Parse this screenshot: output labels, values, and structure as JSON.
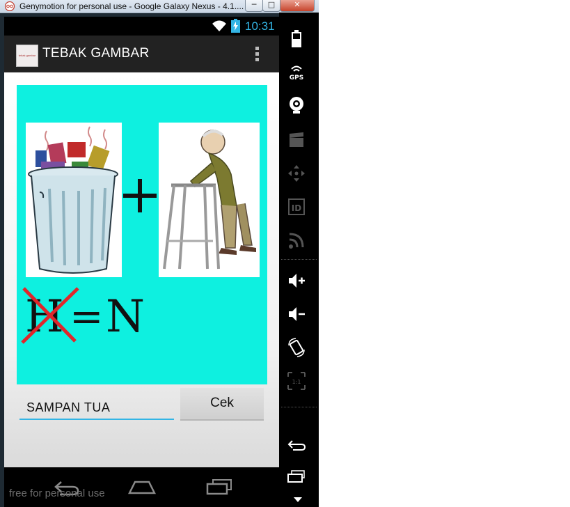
{
  "window": {
    "title": "Genymotion for personal use - Google Galaxy Nexus - 4.1....",
    "minimize_glyph": "─",
    "maximize_glyph": "□",
    "close_glyph": "✕"
  },
  "status_bar": {
    "time": "10:31",
    "icons": [
      "wifi-icon",
      "battery-charging-icon"
    ]
  },
  "action_bar": {
    "app_icon_text": "tebak gambar",
    "title": "TEBAK GAMBAR",
    "overflow_icon": "overflow-menu-icon"
  },
  "puzzle": {
    "background": "#0ef0e0",
    "image_1": "trash-can-image",
    "operator": "+",
    "image_2": "old-man-with-walker-image",
    "crossed_letter": "H",
    "equals": "=",
    "replacement_letter": "N"
  },
  "answer": {
    "value": "SAMPAN TUA",
    "check_button": "Cek"
  },
  "nav_bar": {
    "buttons": [
      "back-icon",
      "home-icon",
      "recent-apps-icon"
    ]
  },
  "watermark": "free for personal use",
  "side_toolbar": {
    "icons": [
      "battery-icon",
      "gps-icon",
      "camera-icon",
      "video-icon",
      "dpad-icon",
      "id-icon",
      "signal-icon",
      "volume-up-icon",
      "volume-down-icon",
      "rotate-icon",
      "scale-icon",
      "back-icon",
      "recent-apps-icon",
      "menu-icon"
    ]
  },
  "colors": {
    "accent": "#33b5e5",
    "action_bar": "#222222",
    "puzzle_bg": "#0ef0e0",
    "cross": "#e0262b"
  }
}
